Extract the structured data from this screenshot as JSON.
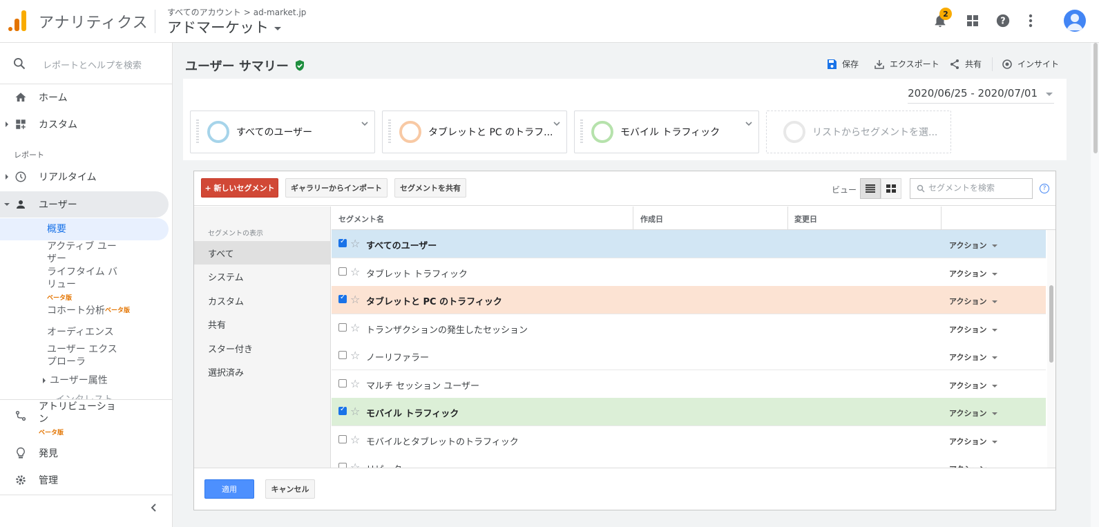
{
  "header": {
    "app_title": "アナリティクス",
    "breadcrumb_all": "すべてのアカウント",
    "breadcrumb_sep": ">",
    "breadcrumb_account": "ad-market.jp",
    "property": "アドマーケット",
    "notification_count": "2"
  },
  "sidebar": {
    "search_placeholder": "レポートとヘルプを検索",
    "home": "ホーム",
    "custom": "カスタム",
    "section_reports": "レポート",
    "realtime": "リアルタイム",
    "user": "ユーザー",
    "sub": {
      "overview": "概要",
      "active_users": "アクティブ ユーザー",
      "lifetime": "ライフタイム バリュー",
      "lifetime_badge": "ベータ版",
      "cohort": "コホート分析",
      "cohort_badge": "ベータ版",
      "audience": "オーディエンス",
      "explorer": "ユーザー エクスプローラ",
      "attributes": "ユーザー属性",
      "cut_off": "インタレスト"
    },
    "attribution": "アトリビューション",
    "attribution_badge": "ベータ版",
    "discover": "発見",
    "admin": "管理"
  },
  "page": {
    "title": "ユーザー サマリー",
    "actions": {
      "save": "保存",
      "export": "エクスポート",
      "share": "共有",
      "insights": "インサイト"
    },
    "date_range": "2020/06/25 - 2020/07/01"
  },
  "segments_bar": [
    {
      "label": "すべてのユーザー",
      "color": "#a6d4ea"
    },
    {
      "label": "タブレットと PC のトラフ...",
      "color": "#f8c9a4"
    },
    {
      "label": "モバイル トラフィック",
      "color": "#b6e2ac"
    },
    {
      "label": "リストからセグメントを選...",
      "color": "#e8e8e8"
    }
  ],
  "editor": {
    "new_segment": "+ 新しいセグメント",
    "import_gallery": "ギャラリーからインポート",
    "share_segment": "セグメントを共有",
    "view_label": "ビュー",
    "search_placeholder": "セグメントを検索",
    "help": "?",
    "filter_header": "セグメントの表示",
    "filters": [
      "すべて",
      "システム",
      "カスタム",
      "共有",
      "スター付き",
      "選択済み"
    ],
    "columns": {
      "name": "セグメント名",
      "created": "作成日",
      "modified": "変更日"
    },
    "action_label": "アクション",
    "rows": [
      {
        "name": "すべてのユーザー",
        "checked": true,
        "bg": "#d2e6f4"
      },
      {
        "name": "タブレット トラフィック",
        "checked": false,
        "bg": "#ffffff"
      },
      {
        "name": "タブレットと PC のトラフィック",
        "checked": true,
        "bg": "#fce3d3"
      },
      {
        "name": "トランザクションの発生したセッション",
        "checked": false,
        "bg": "#ffffff"
      },
      {
        "name": "ノーリファラー",
        "checked": false,
        "bg": "#ffffff"
      },
      {
        "name": "マルチ セッション ユーザー",
        "checked": false,
        "bg": "#ffffff"
      },
      {
        "name": "モバイル トラフィック",
        "checked": true,
        "bg": "#dcefd7"
      },
      {
        "name": "モバイルとタブレットのトラフィック",
        "checked": false,
        "bg": "#ffffff"
      },
      {
        "name": "リピーター",
        "checked": false,
        "bg": "#ffffff"
      }
    ],
    "apply": "適用",
    "cancel": "キャンセル"
  },
  "colors": {
    "accent": "#1a73e8",
    "new_segment": "#d14836",
    "apply": "#4d90fe",
    "verified": "#1e8e3e"
  }
}
